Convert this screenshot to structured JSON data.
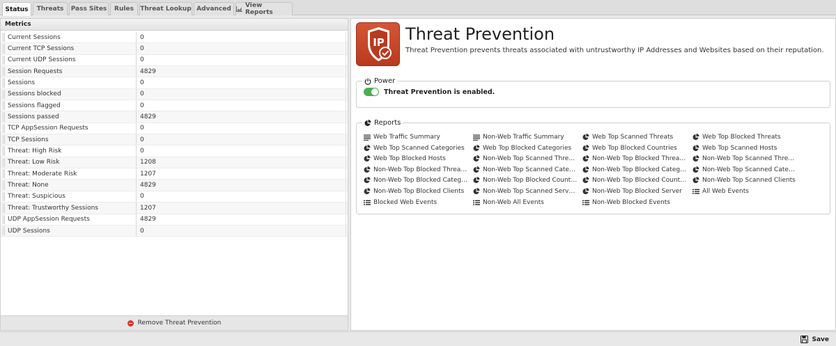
{
  "tabs": [
    {
      "label": "Status",
      "active": true
    },
    {
      "label": "Threats"
    },
    {
      "label": "Pass Sites"
    },
    {
      "label": "Rules"
    },
    {
      "label": "Threat Lookup"
    },
    {
      "label": "Advanced"
    },
    {
      "label": "View Reports",
      "icon": "chart-icon"
    }
  ],
  "metrics": {
    "title": "Metrics",
    "rows": [
      {
        "name": "Current Sessions",
        "value": "0"
      },
      {
        "name": "Current TCP Sessions",
        "value": "0"
      },
      {
        "name": "Current UDP Sessions",
        "value": "0"
      },
      {
        "name": "Session Requests",
        "value": "4829"
      },
      {
        "name": "Sessions",
        "value": "0"
      },
      {
        "name": "Sessions blocked",
        "value": "0"
      },
      {
        "name": "Sessions flagged",
        "value": "0"
      },
      {
        "name": "Sessions passed",
        "value": "4829"
      },
      {
        "name": "TCP AppSession Requests",
        "value": "0"
      },
      {
        "name": "TCP Sessions",
        "value": "0"
      },
      {
        "name": "Threat: High Risk",
        "value": "0"
      },
      {
        "name": "Threat: Low Risk",
        "value": "1208"
      },
      {
        "name": "Threat: Moderate Risk",
        "value": "1207"
      },
      {
        "name": "Threat: None",
        "value": "4829"
      },
      {
        "name": "Threat: Suspicious",
        "value": "0"
      },
      {
        "name": "Threat: Trustworthy Sessions",
        "value": "1207"
      },
      {
        "name": "UDP AppSession Requests",
        "value": "4829"
      },
      {
        "name": "UDP Sessions",
        "value": "0"
      }
    ],
    "remove_label": "Remove Threat Prevention"
  },
  "app": {
    "icon_text": "IP",
    "title": "Threat Prevention",
    "description": "Threat Prevention prevents threats associated with untrustworthy IP Addresses and Websites based on their reputation."
  },
  "power": {
    "legend": "Power",
    "status": "Threat Prevention is enabled.",
    "enabled": true
  },
  "reports": {
    "legend": "Reports",
    "items": [
      {
        "label": "Web Traffic Summary",
        "icon": "lines-icon"
      },
      {
        "label": "Non-Web Traffic Summary",
        "icon": "lines-icon"
      },
      {
        "label": "Web Top Scanned Threats",
        "icon": "pie-icon"
      },
      {
        "label": "Web Top Blocked Threats",
        "icon": "pie-icon"
      },
      {
        "label": "Web Top Scanned Categories",
        "icon": "pie-icon"
      },
      {
        "label": "Web Top Blocked Categories",
        "icon": "pie-icon"
      },
      {
        "label": "Web Top Blocked Countries",
        "icon": "pie-icon"
      },
      {
        "label": "Web Top Scanned Hosts",
        "icon": "pie-icon"
      },
      {
        "label": "Web Top Blocked Hosts",
        "icon": "pie-icon"
      },
      {
        "label": "Non-Web Top Scanned Threats (...",
        "icon": "pie-icon"
      },
      {
        "label": "Non-Web Top Blocked Threats (...",
        "icon": "pie-icon"
      },
      {
        "label": "Non-Web Top Scanned Threats (...",
        "icon": "pie-icon"
      },
      {
        "label": "Non-Web Top Blocked Threats (...",
        "icon": "pie-icon"
      },
      {
        "label": "Non-Web Top Scanned Categori...",
        "icon": "pie-icon"
      },
      {
        "label": "Non-Web Top Blocked Categorie...",
        "icon": "pie-icon"
      },
      {
        "label": "Non-Web Top Scanned Categori...",
        "icon": "pie-icon"
      },
      {
        "label": "Non-Web Top Blocked Categorie...",
        "icon": "pie-icon"
      },
      {
        "label": "Non-Web Top Blocked Countries...",
        "icon": "pie-icon"
      },
      {
        "label": "Non-Web Top Blocked Countries...",
        "icon": "pie-icon"
      },
      {
        "label": "Non-Web Top Scanned Clients",
        "icon": "pie-icon"
      },
      {
        "label": "Non-Web Top Blocked Clients",
        "icon": "pie-icon"
      },
      {
        "label": "Non-Web Top Scanned Servers",
        "icon": "pie-icon"
      },
      {
        "label": "Non-Web Top Blocked Server",
        "icon": "pie-icon"
      },
      {
        "label": "All Web Events",
        "icon": "list-icon"
      },
      {
        "label": "Blocked Web Events",
        "icon": "list-icon"
      },
      {
        "label": "Non-Web All Events",
        "icon": "list-icon"
      },
      {
        "label": "Non-Web Blocked Events",
        "icon": "list-icon"
      }
    ]
  },
  "footer": {
    "save_label": "Save"
  },
  "colors": {
    "accent_icon": "#c2452a",
    "toggle_on": "#4caf50",
    "remove_red": "#e0302a"
  }
}
